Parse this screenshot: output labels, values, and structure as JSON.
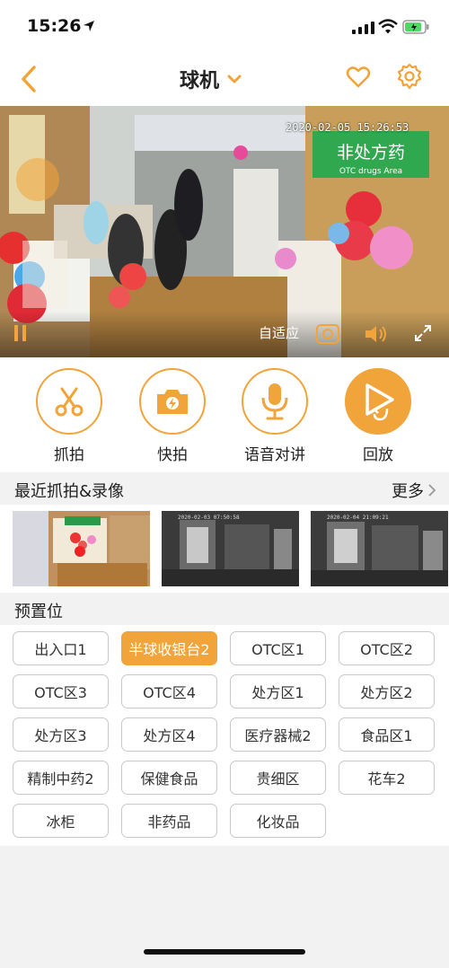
{
  "status_bar": {
    "time": "15:26"
  },
  "nav": {
    "title": "球机",
    "icons": [
      "back-arrow-icon",
      "chevron-down-icon",
      "heart-icon",
      "gear-icon"
    ]
  },
  "video": {
    "timestamp": "2020-02-05  15:26:53",
    "sign_text": "非处方药",
    "sign_subtext": "OTC drugs Area",
    "adaptive_label": "自适应",
    "controls": [
      "pause-icon",
      "camera-icon",
      "speaker-icon",
      "fullscreen-icon"
    ]
  },
  "actions": [
    {
      "label": "抓拍",
      "icon": "scissors-icon"
    },
    {
      "label": "快拍",
      "icon": "flash-camera-icon"
    },
    {
      "label": "语音对讲",
      "icon": "microphone-icon"
    },
    {
      "label": "回放",
      "icon": "playback-icon"
    }
  ],
  "recent": {
    "title": "最近抓拍&录像",
    "more": "更多",
    "thumbnails": [
      {
        "time": ""
      },
      {
        "time": "2020-02-03 07:50:58"
      },
      {
        "time": "2020-02-04 21:09:21"
      }
    ]
  },
  "presets": {
    "title": "预置位",
    "selected": "半球收银台2",
    "items": [
      "出入口1",
      "半球收银台2",
      "OTC区1",
      "OTC区2",
      "OTC区3",
      "OTC区4",
      "处方区1",
      "处方区2",
      "处方区3",
      "处方区4",
      "医疗器械2",
      "食品区1",
      "精制中药2",
      "保健食品",
      "贵细区",
      "花车2",
      "冰柜",
      "非药品",
      "化妆品"
    ]
  },
  "colors": {
    "accent": "#f0a43a",
    "background": "#f2f2f2",
    "card": "#ffffff",
    "text": "#222222",
    "border": "#c8c8c8"
  }
}
